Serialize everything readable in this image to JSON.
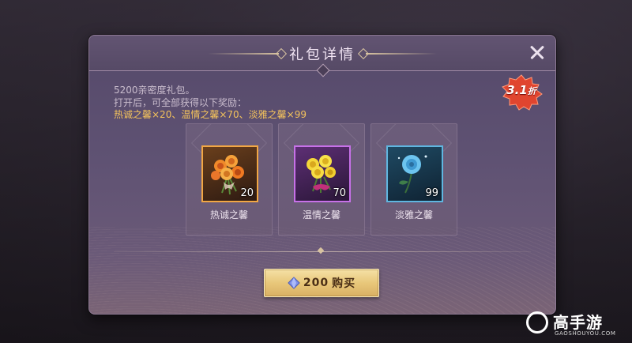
{
  "dialog": {
    "title": "礼包详情",
    "description": [
      "5200亲密度礼包。",
      "打开后，可全部获得以下奖励："
    ],
    "reward_summary": "热诚之馨×20、温情之馨×70、淡雅之馨×99"
  },
  "discount": {
    "value": "3.1",
    "unit": "折"
  },
  "items": [
    {
      "name": "热诚之馨",
      "quantity": "20",
      "frame_color": "#f2a744",
      "icon": "orange-rose-bouquet-icon"
    },
    {
      "name": "温情之馨",
      "quantity": "70",
      "frame_color": "#c771e8",
      "icon": "yellow-rose-bouquet-icon"
    },
    {
      "name": "淡雅之馨",
      "quantity": "99",
      "frame_color": "#5fb6e0",
      "icon": "blue-rose-icon"
    }
  ],
  "buy_button": {
    "price": "200",
    "label": "购买",
    "currency_icon": "diamond-icon"
  },
  "watermark": {
    "brand": "高手游",
    "domain": "GAOSHOUYOU.COM"
  },
  "colors": {
    "accent_gold": "#f3c25c",
    "badge_red": "#e0452f",
    "button_gold": "#e8c77a"
  }
}
